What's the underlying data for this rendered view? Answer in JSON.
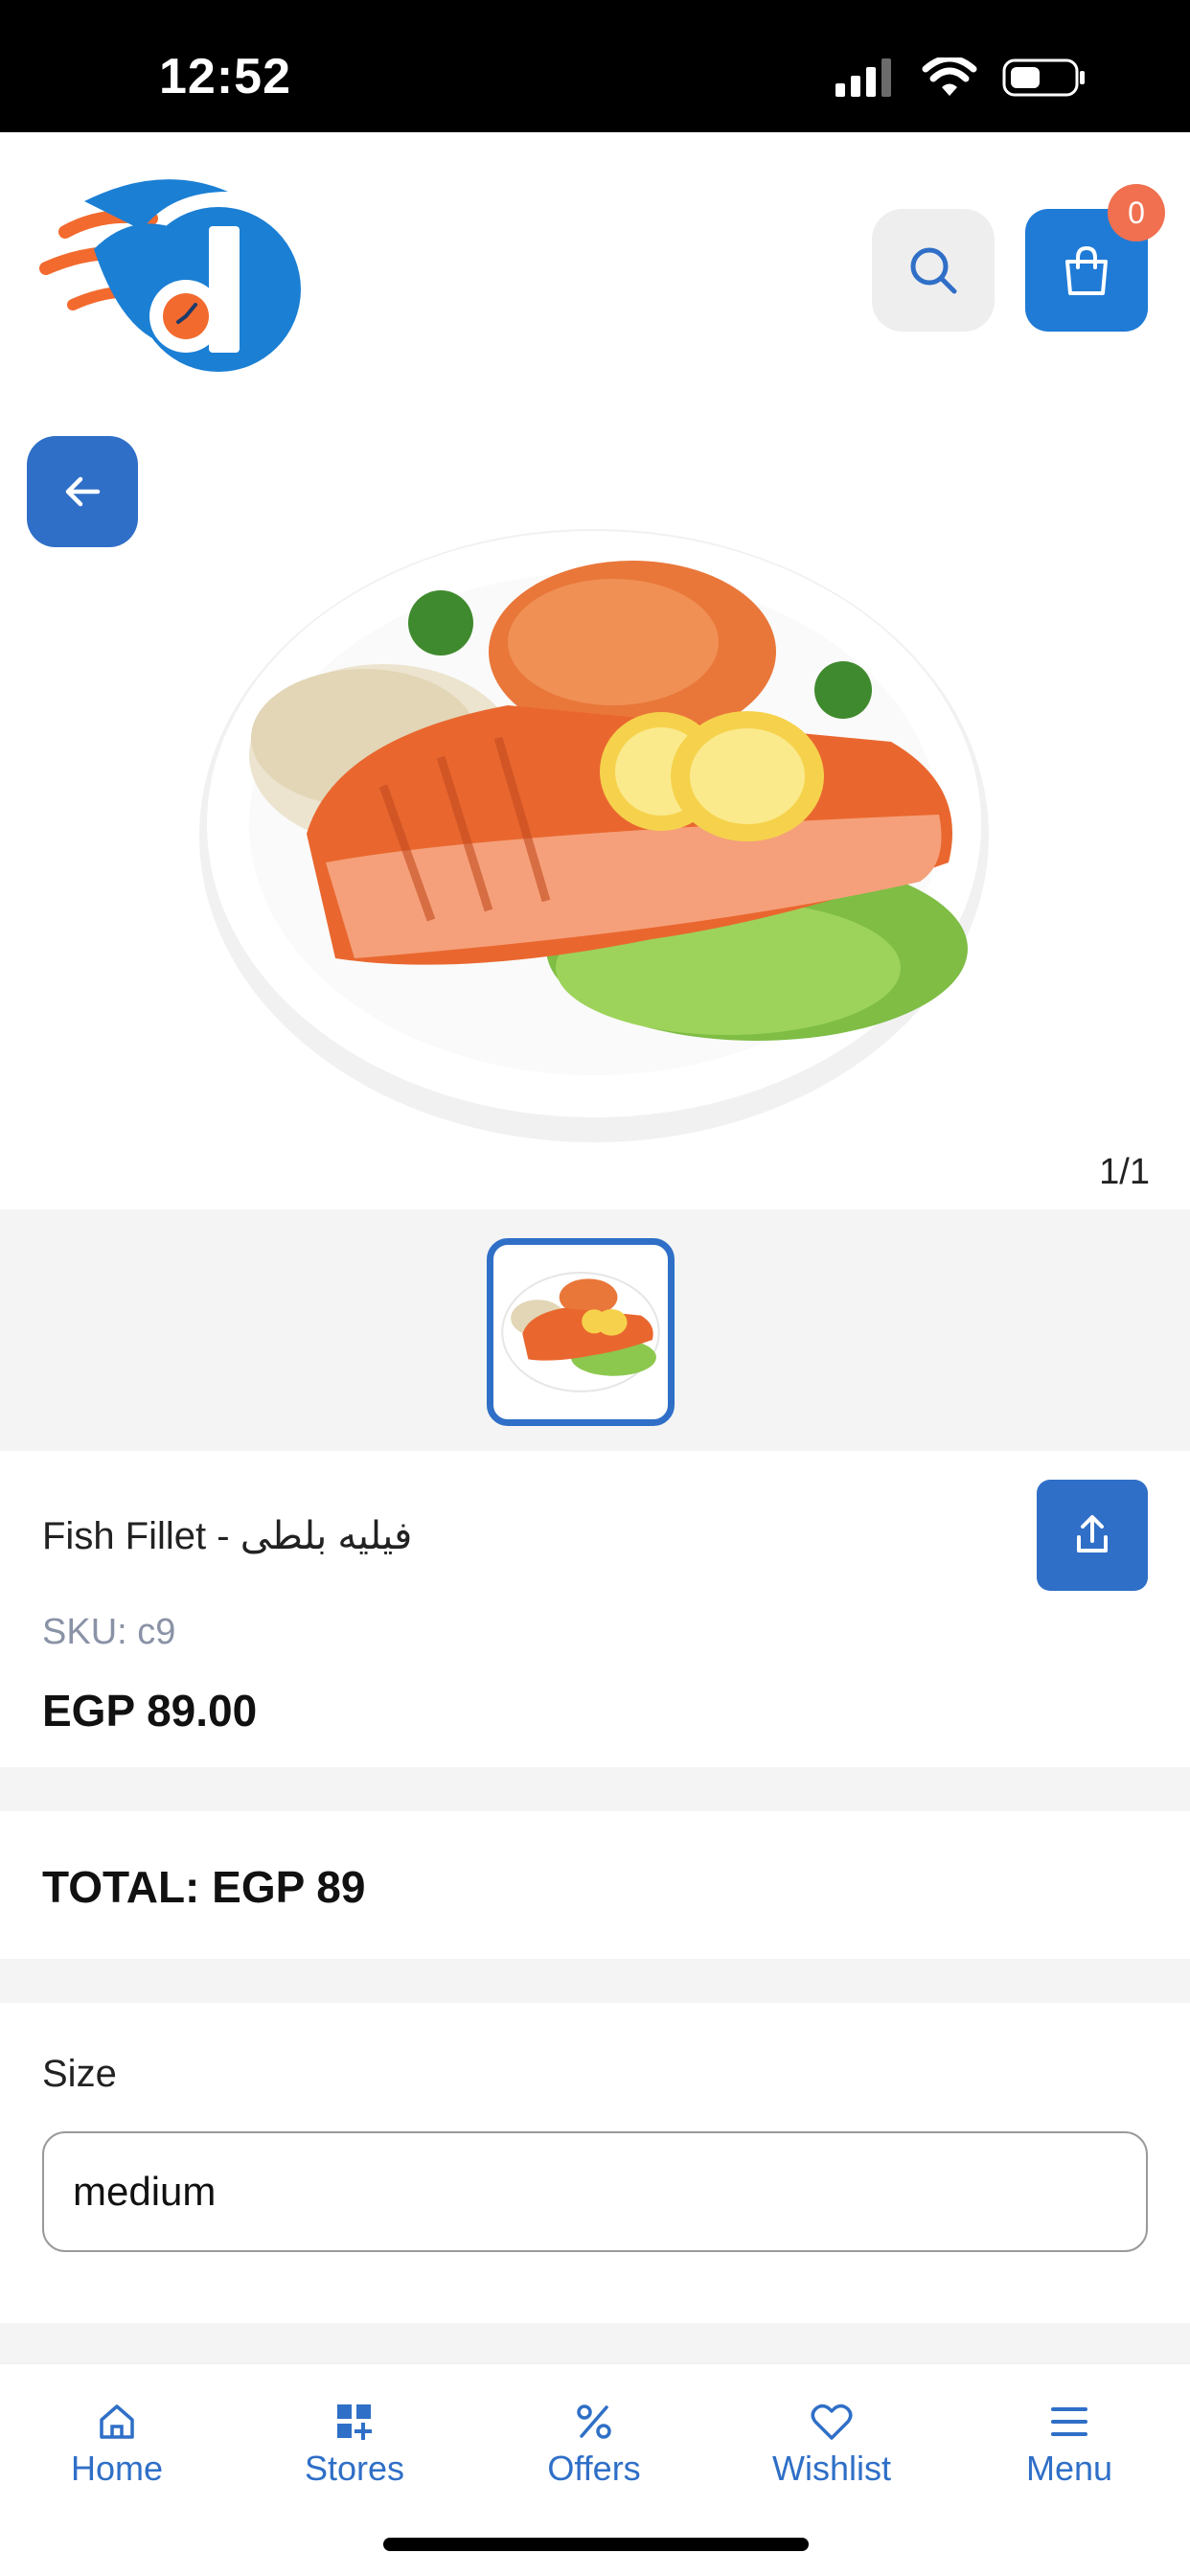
{
  "status_bar": {
    "time": "12:52"
  },
  "header": {
    "cart_count": "0"
  },
  "product": {
    "image_counter": "1/1",
    "name": "Fish Fillet - فيليه بلطى",
    "sku": "SKU: c9",
    "price": "EGP 89.00"
  },
  "total": {
    "text": "TOTAL: EGP 89"
  },
  "options": {
    "size_label": "Size",
    "size_value": "medium"
  },
  "bottom_nav": {
    "items": [
      {
        "label": "Home",
        "icon": "home-icon"
      },
      {
        "label": "Stores",
        "icon": "stores-icon"
      },
      {
        "label": "Offers",
        "icon": "percent-icon"
      },
      {
        "label": "Wishlist",
        "icon": "heart-icon"
      },
      {
        "label": "Menu",
        "icon": "menu-icon"
      }
    ]
  },
  "colors": {
    "primary": "#2f6fc7",
    "cart": "#1f7bd6",
    "badge": "#f0704f",
    "logo_orange": "#f26a2e"
  }
}
